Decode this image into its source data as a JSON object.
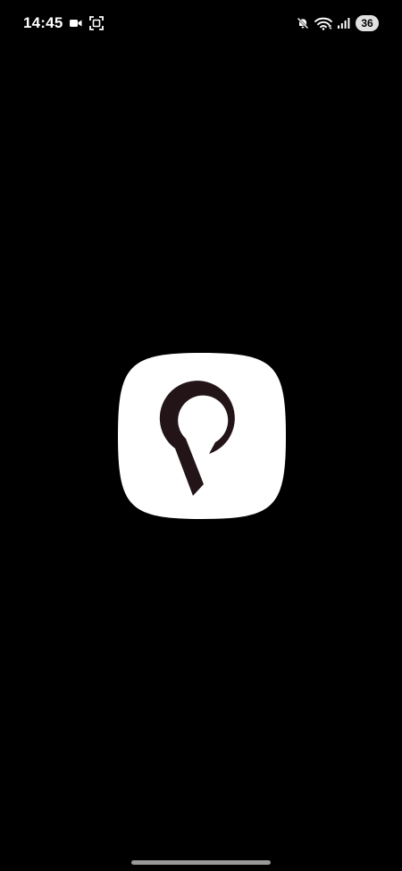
{
  "status_bar": {
    "time": "14:45",
    "battery_level": "36",
    "left_icons": [
      "video-camera-icon",
      "screen-record-icon"
    ],
    "right_icons": [
      "muted-bell-icon",
      "wifi-icon",
      "cellular-signal-icon"
    ]
  },
  "splash": {
    "logo_icon": "location-pin-p-logo-icon",
    "background_color": "#000000",
    "logo_background_color": "#ffffff",
    "logo_mark_color": "#231418"
  },
  "home_indicator": {
    "color": "#9a9a9a"
  }
}
